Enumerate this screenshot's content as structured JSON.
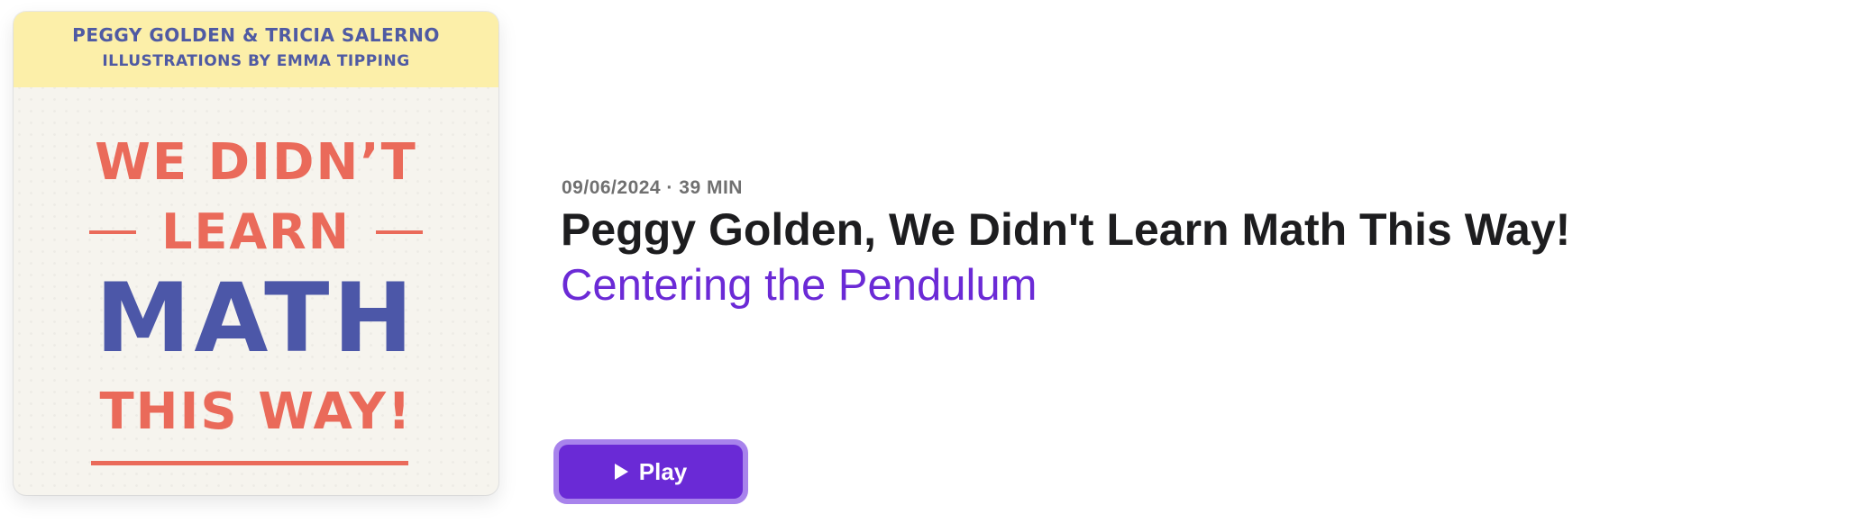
{
  "artwork": {
    "authors": "PEGGY GOLDEN  & TRICIA SALERNO",
    "illustrator": "ILLUSTRATIONS BY EMMA TIPPING",
    "line1": "WE DIDN’T",
    "line2": "LEARN",
    "line3": "MATH",
    "line4": "THIS WAY!"
  },
  "episode": {
    "meta": "09/06/2024 · 39 MIN",
    "title": "Peggy Golden, We Didn't Learn Math This Way!",
    "show": "Centering the Pendulum"
  },
  "play_button": {
    "label": "Play",
    "icon": "play-icon"
  },
  "colors": {
    "accent": "#6a2ad6",
    "accent_ring": "#a883ec",
    "title": "#1d1d1f",
    "meta": "#707070",
    "art_red": "#ea6a5a",
    "art_blue": "#4c57a8",
    "art_yellow": "#fcefa9"
  }
}
